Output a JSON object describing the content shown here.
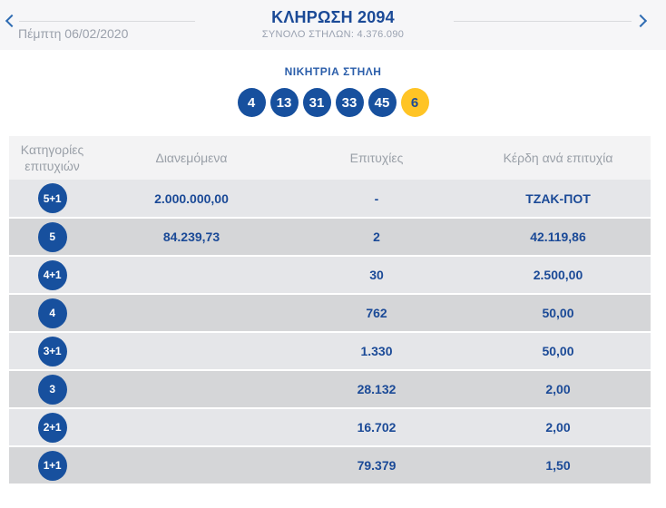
{
  "header": {
    "title": "ΚΛΗΡΩΣΗ 2094",
    "subtitle": "ΣΥΝΟΛΟ ΣΤΗΛΩΝ: 4.376.090",
    "date": "Πέμπτη 06/02/2020",
    "prev_icon": "chevron-left",
    "next_icon": "chevron-right"
  },
  "winning": {
    "label": "ΝΙΚΗΤΡΙΑ ΣΤΗΛΗ",
    "numbers": [
      "4",
      "13",
      "31",
      "33",
      "45"
    ],
    "joker": "6"
  },
  "table": {
    "headers": [
      "Κατηγορίες επιτυχιών",
      "Διανεμόμενα",
      "Επιτυχίες",
      "Κέρδη ανά επιτυχία"
    ],
    "rows": [
      {
        "category": "5+1",
        "distributed": "2.000.000,00",
        "winners": "-",
        "prize": "ΤΖΑΚ-ΠΟΤ"
      },
      {
        "category": "5",
        "distributed": "84.239,73",
        "winners": "2",
        "prize": "42.119,86"
      },
      {
        "category": "4+1",
        "distributed": "",
        "winners": "30",
        "prize": "2.500,00"
      },
      {
        "category": "4",
        "distributed": "",
        "winners": "762",
        "prize": "50,00"
      },
      {
        "category": "3+1",
        "distributed": "",
        "winners": "1.330",
        "prize": "50,00"
      },
      {
        "category": "3",
        "distributed": "",
        "winners": "28.132",
        "prize": "2,00"
      },
      {
        "category": "2+1",
        "distributed": "",
        "winners": "16.702",
        "prize": "2,00"
      },
      {
        "category": "1+1",
        "distributed": "",
        "winners": "79.379",
        "prize": "1,50"
      }
    ]
  },
  "colors": {
    "navy_text": "#1b4a97",
    "ball_blue": "#17509e",
    "joker_yellow": "#ffc425",
    "gray_text": "#9aa0a8",
    "row_light": "#e5e6e9",
    "row_dark": "#d5d6d8",
    "header_row_bg": "#f3f3f4",
    "top_bar_bg": "#f6f6f8"
  }
}
